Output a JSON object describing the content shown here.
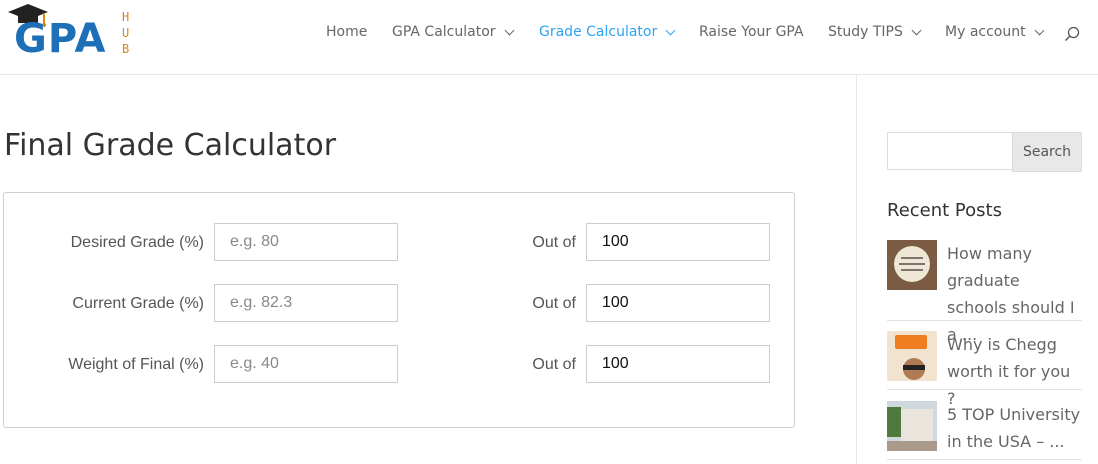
{
  "logo": {
    "g": "G",
    "pa": "PA",
    "hub": [
      "H",
      "U",
      "B"
    ]
  },
  "nav": {
    "items": [
      {
        "label": "Home"
      },
      {
        "label": "GPA Calculator"
      },
      {
        "label": "Grade Calculator"
      },
      {
        "label": "Raise Your GPA"
      },
      {
        "label": "Study TIPS"
      },
      {
        "label": "My account"
      }
    ]
  },
  "page": {
    "title": "Final Grade Calculator"
  },
  "calculator": {
    "rows": [
      {
        "label": "Desired Grade (%)",
        "placeholder": "e.g. 80",
        "out_of_label": "Out of",
        "out_of_value": "100"
      },
      {
        "label": "Current Grade (%)",
        "placeholder": "e.g. 82.3",
        "out_of_label": "Out of",
        "out_of_value": "100"
      },
      {
        "label": "Weight of Final (%)",
        "placeholder": "e.g. 40",
        "out_of_label": "Out of",
        "out_of_value": "100"
      }
    ]
  },
  "sidebar": {
    "search_button": "Search",
    "recent_heading": "Recent Posts",
    "posts": [
      {
        "title": "How many graduate schools should I a ..."
      },
      {
        "title": "Why is Chegg worth it for you ?"
      },
      {
        "title": "5 TOP University in the USA – ..."
      }
    ]
  },
  "colors": {
    "accent": "#2ea3f2",
    "logo_blue": "#1d6fb8",
    "logo_orange": "#d9861a"
  }
}
